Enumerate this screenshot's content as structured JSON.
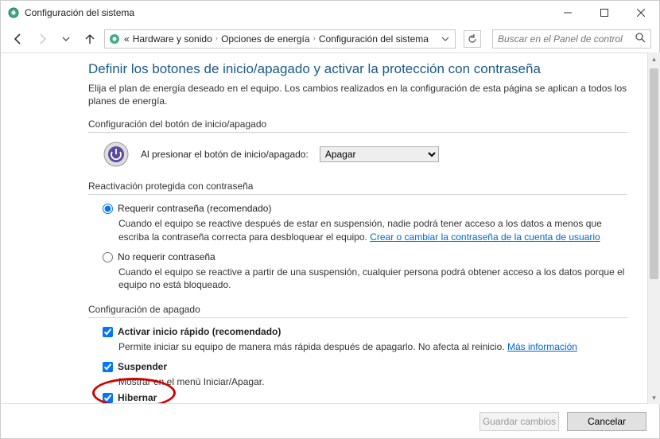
{
  "window": {
    "title": "Configuración del sistema"
  },
  "breadcrumb": {
    "prefix": "«",
    "items": [
      "Hardware y sonido",
      "Opciones de energía",
      "Configuración del sistema"
    ]
  },
  "search": {
    "placeholder": "Buscar en el Panel de control"
  },
  "heading": "Definir los botones de inicio/apagado y activar la protección con contraseña",
  "subtext": "Elija el plan de energía deseado en el equipo. Los cambios realizados en la configuración de esta página se aplican a todos los planes de energía.",
  "group_button": {
    "title": "Configuración del botón de inicio/apagado",
    "label": "Al presionar el botón de inicio/apagado:",
    "selected": "Apagar"
  },
  "group_wake": {
    "title": "Reactivación protegida con contraseña",
    "option1_label": "Requerir contraseña (recomendado)",
    "option1_desc": "Cuando el equipo se reactive después de estar en suspensión, nadie podrá tener acceso a los datos a menos que escriba la contraseña correcta para desbloquear el equipo. ",
    "option1_link": "Crear o cambiar la contraseña de la cuenta de usuario",
    "option2_label": "No requerir contraseña",
    "option2_desc": "Cuando el equipo se reactive a partir de una suspensión, cualquier persona podrá obtener acceso a los datos porque el equipo no está bloqueado."
  },
  "group_shutdown": {
    "title": "Configuración de apagado",
    "opt_faststart_label": "Activar inicio rápido (recomendado)",
    "opt_faststart_desc": "Permite iniciar su equipo de manera más rápida después de apagarlo. No afecta al reinicio. ",
    "opt_faststart_link": "Más información",
    "opt_suspend_label": "Suspender",
    "opt_suspend_desc": "Mostrar en el menú Iniciar/Apagar.",
    "opt_hibernate_label": "Hibernar"
  },
  "footer": {
    "save": "Guardar cambios",
    "cancel": "Cancelar"
  }
}
